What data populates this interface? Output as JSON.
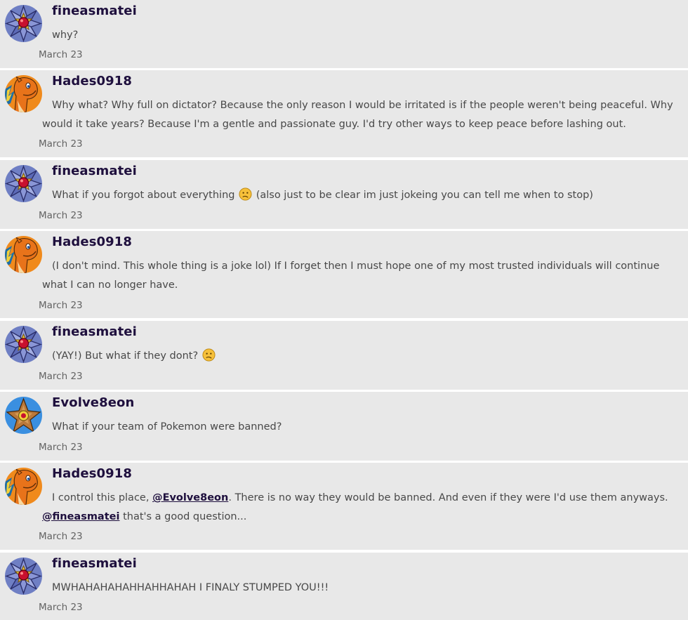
{
  "posts": [
    {
      "author": "fineasmatei",
      "avatar": "starmie-avatar",
      "date": "March 23",
      "text": "why?"
    },
    {
      "author": "Hades0918",
      "avatar": "charizard-avatar",
      "date": "March 23",
      "text": "Why what? Why full on dictator? Because the only reason I would be irritated is if the people weren't being peaceful. Why would it take years? Because I'm a gentle and passionate guy. I'd try other ways to keep peace before lashing out."
    },
    {
      "author": "fineasmatei",
      "avatar": "starmie-avatar",
      "date": "March 23",
      "text_a": "What if you forgot about everything",
      "emoji": "confused-face-emoji",
      "text_b": "(also just to be clear im just jokeing you can tell me when to stop)"
    },
    {
      "author": "Hades0918",
      "avatar": "charizard-avatar",
      "date": "March 23",
      "text": "(I don't mind. This whole thing is a joke lol) If I forget then I must hope one of my most trusted individuals will continue what I can no longer have."
    },
    {
      "author": "fineasmatei",
      "avatar": "starmie-avatar",
      "date": "March 23",
      "text_a": "(YAY!) But what if they dont?",
      "emoji": "confused-face-emoji"
    },
    {
      "author": "Evolve8eon",
      "avatar": "staryu-avatar",
      "date": "March 23",
      "text": "What if your team of Pokemon were banned?"
    },
    {
      "author": "Hades0918",
      "avatar": "charizard-avatar",
      "date": "March 23",
      "text_a": "I control this place,",
      "mention_1": "@Evolve8eon",
      "text_b": ". There is no way they would be banned. And even if they were I'd use them anyways.",
      "mention_2": "@fineasmatei",
      "text_c": "that's a good question..."
    },
    {
      "author": "fineasmatei",
      "avatar": "starmie-avatar",
      "date": "March 23",
      "text": "MWHAHAHAHAHHAHHAHAH I FINALY STUMPED YOU!!!"
    }
  ],
  "colors": {
    "post_background": "#e8e8e8",
    "username": "#1e0f3d",
    "body_text": "#484848",
    "date": "#636363"
  }
}
